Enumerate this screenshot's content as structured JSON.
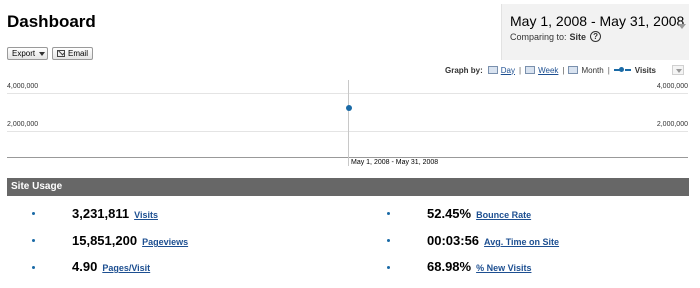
{
  "header": {
    "title": "Dashboard",
    "date_range": "May 1, 2008 - May 31, 2008",
    "comparing_label": "Comparing to:",
    "comparing_value": "Site",
    "help_glyph": "?"
  },
  "toolbar": {
    "export_label": "Export",
    "email_label": "Email"
  },
  "graph_by": {
    "label": "Graph by:",
    "options": [
      "Day",
      "Week",
      "Month"
    ],
    "separator": "|",
    "metric": "Visits"
  },
  "chart": {
    "y_ticks_left": [
      "4,000,000",
      "2,000,000"
    ],
    "y_ticks_right": [
      "4,000,000",
      "2,000,000"
    ],
    "x_label": "May 1, 2008 - May 31, 2008"
  },
  "chart_data": {
    "type": "line",
    "x": [
      "May 1, 2008 - May 31, 2008"
    ],
    "series": [
      {
        "name": "Visits",
        "values": [
          3231811
        ]
      }
    ],
    "ylim": [
      0,
      5000000
    ],
    "y_ticks": [
      2000000,
      4000000
    ],
    "grid": true,
    "colors": {
      "series": "#1a6aa6"
    }
  },
  "site_usage": {
    "title": "Site Usage",
    "metrics_left": [
      {
        "value": "3,231,811",
        "label": "Visits"
      },
      {
        "value": "15,851,200",
        "label": "Pageviews"
      },
      {
        "value": "4.90",
        "label": "Pages/Visit"
      }
    ],
    "metrics_right": [
      {
        "value": "52.45%",
        "label": "Bounce Rate"
      },
      {
        "value": "00:03:56",
        "label": "Avg. Time on Site"
      },
      {
        "value": "68.98%",
        "label": "% New Visits"
      }
    ]
  },
  "colors": {
    "link": "#1d4f91",
    "section_bar": "#676767",
    "accent": "#1a6aa6"
  }
}
